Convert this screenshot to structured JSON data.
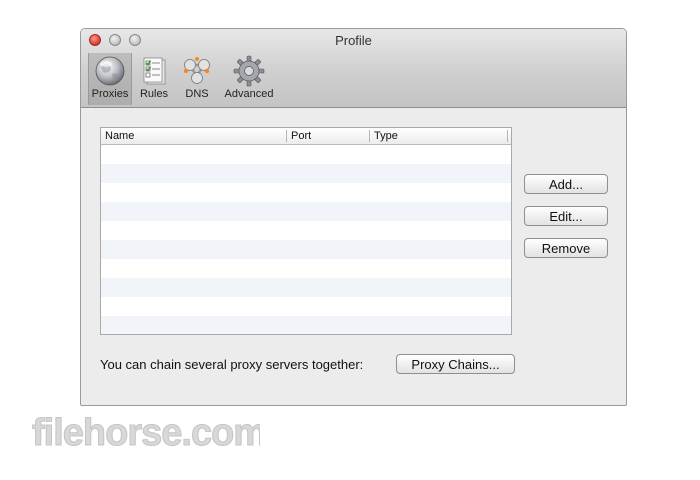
{
  "window": {
    "title": "Profile"
  },
  "toolbar": {
    "items": [
      {
        "label": "Proxies",
        "icon": "globe-icon"
      },
      {
        "label": "Rules",
        "icon": "checklist-icon"
      },
      {
        "label": "DNS",
        "icon": "dns-nodes-icon"
      },
      {
        "label": "Advanced",
        "icon": "gear-icon"
      }
    ],
    "selected": "Proxies"
  },
  "table": {
    "columns": [
      "Name",
      "Port",
      "Type"
    ],
    "rows": []
  },
  "buttons": {
    "add": "Add...",
    "edit": "Edit...",
    "remove": "Remove",
    "proxy_chains": "Proxy Chains..."
  },
  "chain": {
    "text": "You can chain several proxy servers together:"
  },
  "watermark": {
    "text": "filehorse.com"
  },
  "colors": {
    "close": "#e0443a",
    "row_alt": "#f1f5fa",
    "window_bg": "#ececec"
  }
}
